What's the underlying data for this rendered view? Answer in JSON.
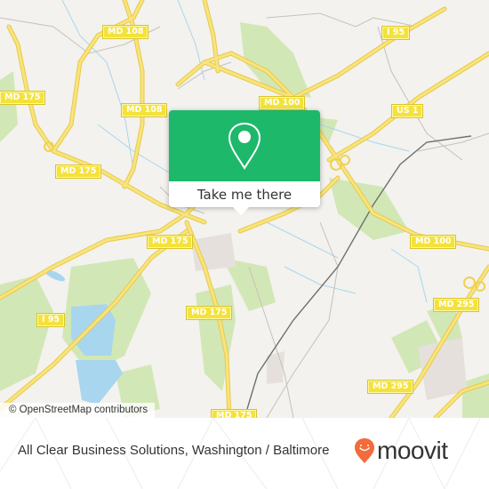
{
  "map": {
    "road_labels": [
      {
        "id": "md108-top",
        "text": "MD 108"
      },
      {
        "id": "md108-mid",
        "text": "MD 108"
      },
      {
        "id": "md175-left",
        "text": "MD 175"
      },
      {
        "id": "md175-a",
        "text": "MD 175"
      },
      {
        "id": "md175-b",
        "text": "MD 175"
      },
      {
        "id": "md175-c",
        "text": "MD 175"
      },
      {
        "id": "md175-bottom",
        "text": "MD 175"
      },
      {
        "id": "i95-top",
        "text": "I 95"
      },
      {
        "id": "i95-left",
        "text": "I 95"
      },
      {
        "id": "md100-a",
        "text": "MD 100"
      },
      {
        "id": "md100-b",
        "text": "MD 100"
      },
      {
        "id": "us1",
        "text": "US 1"
      },
      {
        "id": "md295-a",
        "text": "MD 295"
      },
      {
        "id": "md295-b",
        "text": "MD 295"
      }
    ],
    "attribution": "© OpenStreetMap contributors",
    "colors": {
      "land": "#f3f2ee",
      "road": "#f7e169",
      "green": "#cfe6b0",
      "water": "#a8d6ef",
      "shield": "#f4e23b"
    }
  },
  "popup": {
    "icon": "map-pin-icon",
    "button_label": "Take me there",
    "color": "#1db86a"
  },
  "footer": {
    "title": "All Clear Business Solutions, Washington / Baltimore",
    "brand": "moovit",
    "brand_color": "#f26b3a"
  }
}
